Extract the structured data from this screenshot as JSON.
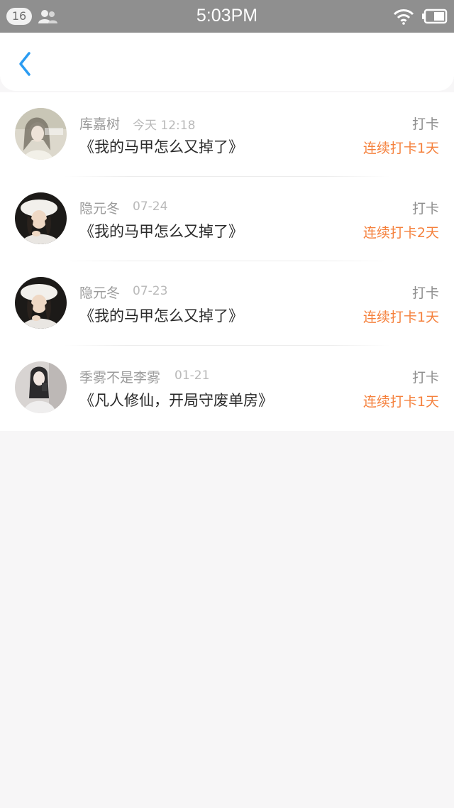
{
  "status_bar": {
    "badge": "16",
    "time": "5:03PM",
    "icons": [
      "contacts-icon",
      "wifi-icon",
      "battery-icon"
    ]
  },
  "header": {
    "back_icon": "chevron-left-icon"
  },
  "colors": {
    "accent_blue": "#2b9cf2",
    "streak_orange": "#f5813d"
  },
  "checkins": [
    {
      "user": "库嘉树",
      "date": "今天 12:18",
      "book": "《我的马甲怎么又掉了》",
      "tag": "打卡",
      "streak": "连续打卡1天"
    },
    {
      "user": "隐元冬",
      "date": "07-24",
      "book": "《我的马甲怎么又掉了》",
      "tag": "打卡",
      "streak": "连续打卡2天"
    },
    {
      "user": "隐元冬",
      "date": "07-23",
      "book": "《我的马甲怎么又掉了》",
      "tag": "打卡",
      "streak": "连续打卡1天"
    },
    {
      "user": "季雾不是李雾",
      "date": "01-21",
      "book": "《凡人修仙，开局守废单房》",
      "tag": "打卡",
      "streak": "连续打卡1天"
    }
  ]
}
